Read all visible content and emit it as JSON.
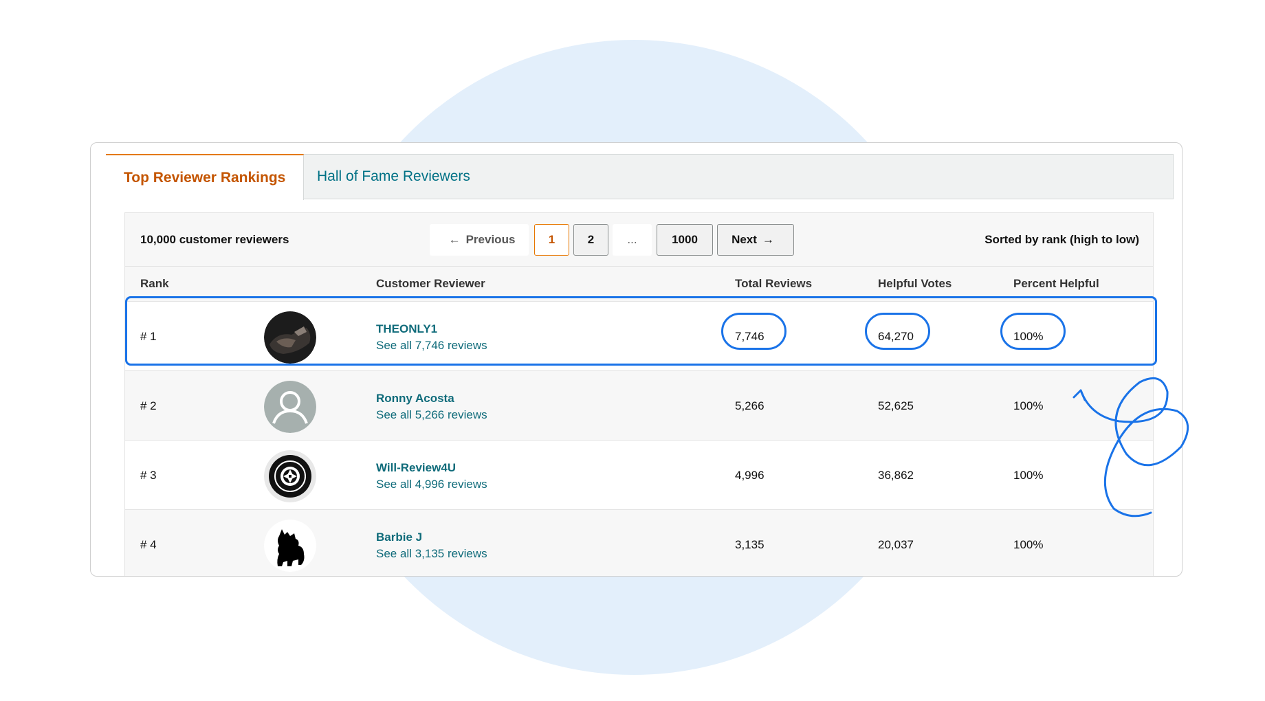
{
  "tabs": {
    "active": "Top Reviewer Rankings",
    "inactive": "Hall of Fame Reviewers"
  },
  "toolbar": {
    "count": "10,000 customer reviewers",
    "sorted": "Sorted by rank (high to low)"
  },
  "pagination": {
    "previous": "Previous",
    "page1": "1",
    "page2": "2",
    "ellipsis": "...",
    "last": "1000",
    "next": "Next"
  },
  "columns": {
    "rank": "Rank",
    "reviewer": "Customer Reviewer",
    "total": "Total Reviews",
    "helpful": "Helpful Votes",
    "percent": "Percent Helpful"
  },
  "rows": [
    {
      "rank": "# 1",
      "name": "THEONLY1",
      "see_all": "See all 7,746 reviews",
      "total": "7,746",
      "helpful": "64,270",
      "percent": "100%",
      "avatar": "photo-avatar"
    },
    {
      "rank": "# 2",
      "name": "Ronny Acosta",
      "see_all": "See all 5,266 reviews",
      "total": "5,266",
      "helpful": "52,625",
      "percent": "100%",
      "avatar": "default-user-icon"
    },
    {
      "rank": "# 3",
      "name": "Will-Review4U",
      "see_all": "See all 4,996 reviews",
      "total": "4,996",
      "helpful": "36,862",
      "percent": "100%",
      "avatar": "camera-aperture-logo"
    },
    {
      "rank": "# 4",
      "name": "Barbie J",
      "see_all": "See all 3,135 reviews",
      "total": "3,135",
      "helpful": "20,037",
      "percent": "100%",
      "avatar": "dog-silhouette-icon"
    }
  ],
  "colors": {
    "accent": "#1a73e8",
    "tab_active": "#c45500",
    "link": "#0f6b7a",
    "bg_circle": "#e3effb"
  }
}
